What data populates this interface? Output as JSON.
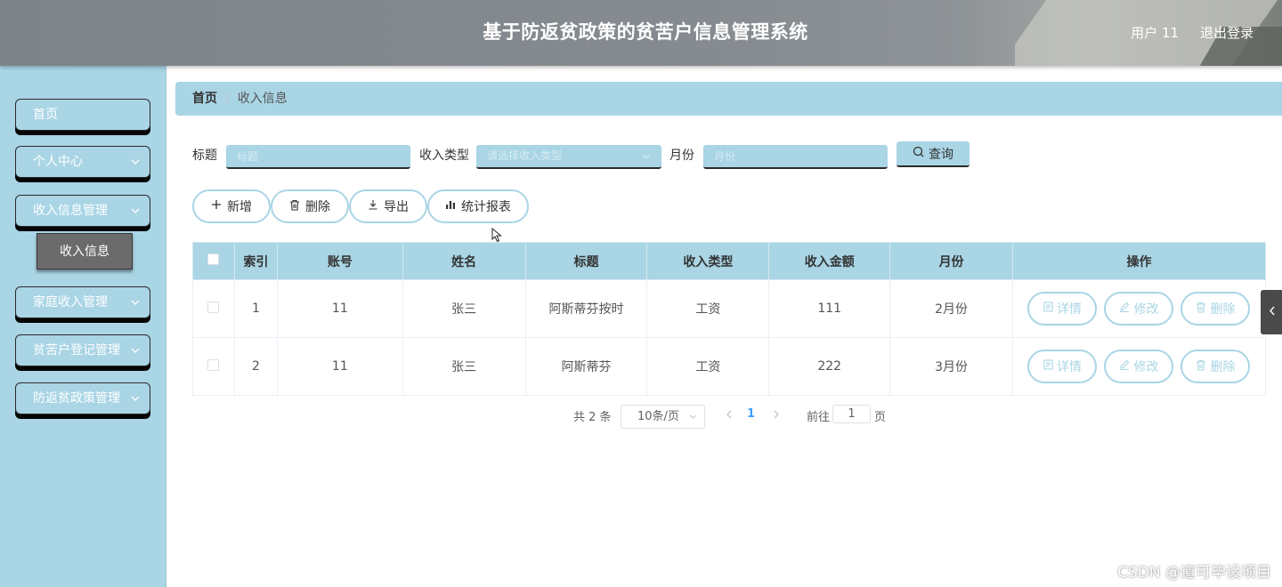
{
  "header": {
    "title": "基于防返贫政策的贫苦户信息管理系统",
    "user": "用户 11",
    "logout": "退出登录"
  },
  "sidebar": {
    "items": [
      {
        "label": "首页"
      },
      {
        "label": "个人中心"
      },
      {
        "label": "收入信息管理"
      },
      {
        "label": "家庭收入管理"
      },
      {
        "label": "贫苦户登记管理"
      },
      {
        "label": "防返贫政策管理"
      }
    ],
    "active_sub": "收入信息"
  },
  "breadcrumb": {
    "home": "首页",
    "current": "收入信息"
  },
  "search": {
    "title_label": "标题",
    "title_placeholder": "标题",
    "type_label": "收入类型",
    "type_placeholder": "请选择收入类型",
    "month_label": "月份",
    "month_placeholder": "月份",
    "query": "查询"
  },
  "actions": {
    "add": "新增",
    "delete": "删除",
    "export": "导出",
    "report": "统计报表"
  },
  "table": {
    "columns": [
      "索引",
      "账号",
      "姓名",
      "标题",
      "收入类型",
      "收入金额",
      "月份",
      "操作"
    ],
    "rows": [
      {
        "index": "1",
        "account": "11",
        "name": "张三",
        "title": "阿斯蒂芬按时",
        "type": "工资",
        "amount": "111",
        "month": "2月份"
      },
      {
        "index": "2",
        "account": "11",
        "name": "张三",
        "title": "阿斯蒂芬",
        "type": "工资",
        "amount": "222",
        "month": "3月份"
      }
    ],
    "ops": {
      "detail": "详情",
      "edit": "修改",
      "delete": "删除"
    }
  },
  "pagination": {
    "total": "共 2 条",
    "page_size": "10条/页",
    "current": "1",
    "goto": "前往",
    "goto_value": "1",
    "page_unit": "页"
  },
  "watermark": "CSDN @道可毕设项目",
  "colors": {
    "accent": "#a9d5e5",
    "menu_shadow": "#050505",
    "active_page": "#409eff"
  }
}
